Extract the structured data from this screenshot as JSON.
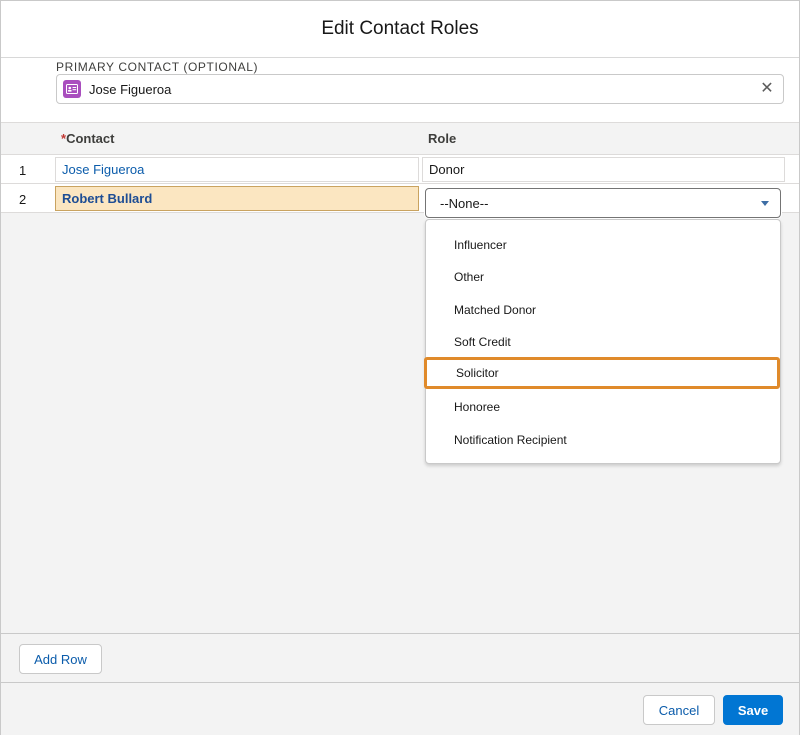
{
  "modal": {
    "title": "Edit Contact Roles"
  },
  "primary_contact": {
    "label": "PRIMARY CONTACT (OPTIONAL)",
    "value": "Jose Figueroa",
    "icon": "contact-card-icon",
    "icon_color": "#a94ebe"
  },
  "table": {
    "columns": {
      "contact_required": "*",
      "contact": "Contact",
      "role": "Role"
    },
    "rows": [
      {
        "num": "1",
        "contact": "Jose Figueroa",
        "role": "Donor"
      },
      {
        "num": "2",
        "contact": "Robert Bullard",
        "role": "--None--"
      }
    ]
  },
  "role_dropdown": {
    "selected": "--None--",
    "options": [
      "Influencer",
      "Other",
      "Matched Donor",
      "Soft Credit",
      "Solicitor",
      "Honoree",
      "Notification Recipient"
    ],
    "highlighted": "Solicitor",
    "highlight_color": "#e08a2a"
  },
  "buttons": {
    "add_row": "Add Row",
    "cancel": "Cancel",
    "save": "Save"
  },
  "colors": {
    "brand": "#0176d3",
    "link": "#0b5cab",
    "selected_cell": "#fbe6c1"
  }
}
